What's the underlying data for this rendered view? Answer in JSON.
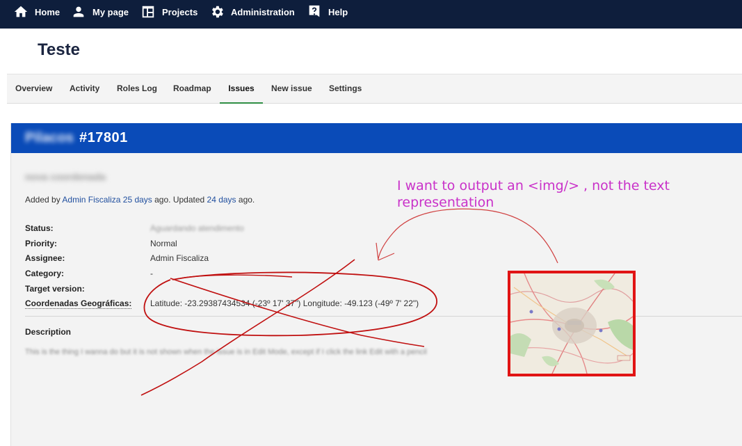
{
  "topnav": {
    "home": "Home",
    "my_page": "My page",
    "projects": "Projects",
    "administration": "Administration",
    "help": "Help"
  },
  "project": {
    "title": "Teste"
  },
  "tabs": [
    {
      "label": "Overview"
    },
    {
      "label": "Activity"
    },
    {
      "label": "Roles Log"
    },
    {
      "label": "Roadmap"
    },
    {
      "label": "Issues",
      "active": true
    },
    {
      "label": "New issue"
    },
    {
      "label": "Settings"
    }
  ],
  "issue": {
    "tracker": "Pilacos",
    "number": "#17801",
    "subject": "nova coordenada",
    "added_prefix": "Added by ",
    "author": "Admin Fiscaliza",
    "created_ago": "25 days",
    "updated_mid": " ago. Updated ",
    "updated_ago": "24 days",
    "ago_suffix": " ago.",
    "attributes": {
      "status_label": "Status:",
      "status_value": "Aguardando atendimento",
      "priority_label": "Priority:",
      "priority_value": "Normal",
      "assignee_label": "Assignee:",
      "assignee_value": "Admin Fiscaliza",
      "category_label": "Category:",
      "category_value": "-",
      "target_label": "Target version:",
      "target_value": "",
      "coords_label": "Coordenadas Geográficas:",
      "coords_value": "Latitude: -23.29387434534 (-23º 17' 37\") Longitude: -49.123 (-49º 7' 22\")"
    },
    "description_label": "Description",
    "description_text": "This is the thing I wanna do but it is not shown when the issue is in Edit Mode, except if I click the link Edit with a pencil"
  },
  "annotation": {
    "note": "I want to output an <img/> , not the text representation",
    "color": "#c931c9"
  },
  "colors": {
    "topbar": "#0e1e3c",
    "issue_header": "#0a4bb8",
    "link": "#1f4e9e",
    "active_tab": "#2f8f44",
    "highlight_box": "#e11414",
    "scribble": "#c01010"
  }
}
